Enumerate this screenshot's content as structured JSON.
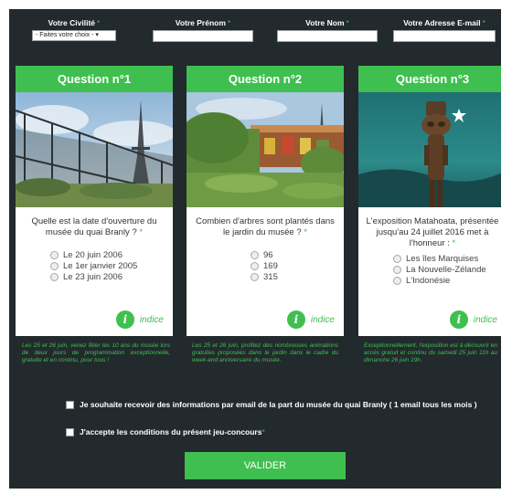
{
  "colors": {
    "background": "#232a2d",
    "accent": "#3fbf4f",
    "card": "#ffffff"
  },
  "form": {
    "civility": {
      "label": "Votre Civilité",
      "required_mark": "*",
      "selected": "- Faites votre choix -"
    },
    "firstname": {
      "label": "Votre Prénom",
      "required_mark": "*",
      "value": ""
    },
    "lastname": {
      "label": "Votre Nom",
      "required_mark": "*",
      "value": ""
    },
    "email": {
      "label": "Votre Adresse E-mail",
      "required_mark": "*",
      "value": ""
    }
  },
  "questions": [
    {
      "title": "Question n°1",
      "text": "Quelle est la date d'ouverture du musée du quai Branly ?",
      "required_mark": "*",
      "options": [
        "Le 20 juin 2006",
        "Le 1er janvier 2005",
        "Le 23 juin 2006"
      ],
      "hint_label": "indice",
      "hint_icon": "i",
      "caption": "Les 25 et 26 juin, venez fêter les 10 ans du musée lors de deux jours de programmation exceptionnelle, gratuite et en continu, pour tous !"
    },
    {
      "title": "Question n°2",
      "text": "Combien d'arbres sont plantés dans le jardin du musée ?",
      "required_mark": "*",
      "options": [
        "96",
        "169",
        "315"
      ],
      "hint_label": "indice",
      "hint_icon": "i",
      "caption": "Les 25 et 26 juin, profitez des nombreuses animations gratuites proposées dans le jardin dans le cadre du week-end anniversaire du musée."
    },
    {
      "title": "Question n°3",
      "text": "L'exposition Matahoata, présentée jusqu'au 24 juillet 2016 met à l'honneur :",
      "required_mark": "*",
      "options": [
        "Les îles Marquises",
        "La Nouvelle-Zélande",
        "L'Indonésie"
      ],
      "hint_label": "indice",
      "hint_icon": "i",
      "caption": "Exceptionnellement, l'exposition est à découvrir en accès gratuit et continu du samedi 25 juin 11h au dimanche 26 juin 19h."
    }
  ],
  "consents": {
    "newsletter": "Je souhaite recevoir des informations par email de la part du musée du quai Branly ( 1 email tous les mois )",
    "rules": "J'accepte les conditions du présent jeu-concours",
    "rules_required_mark": "*"
  },
  "submit_label": "VALIDER"
}
